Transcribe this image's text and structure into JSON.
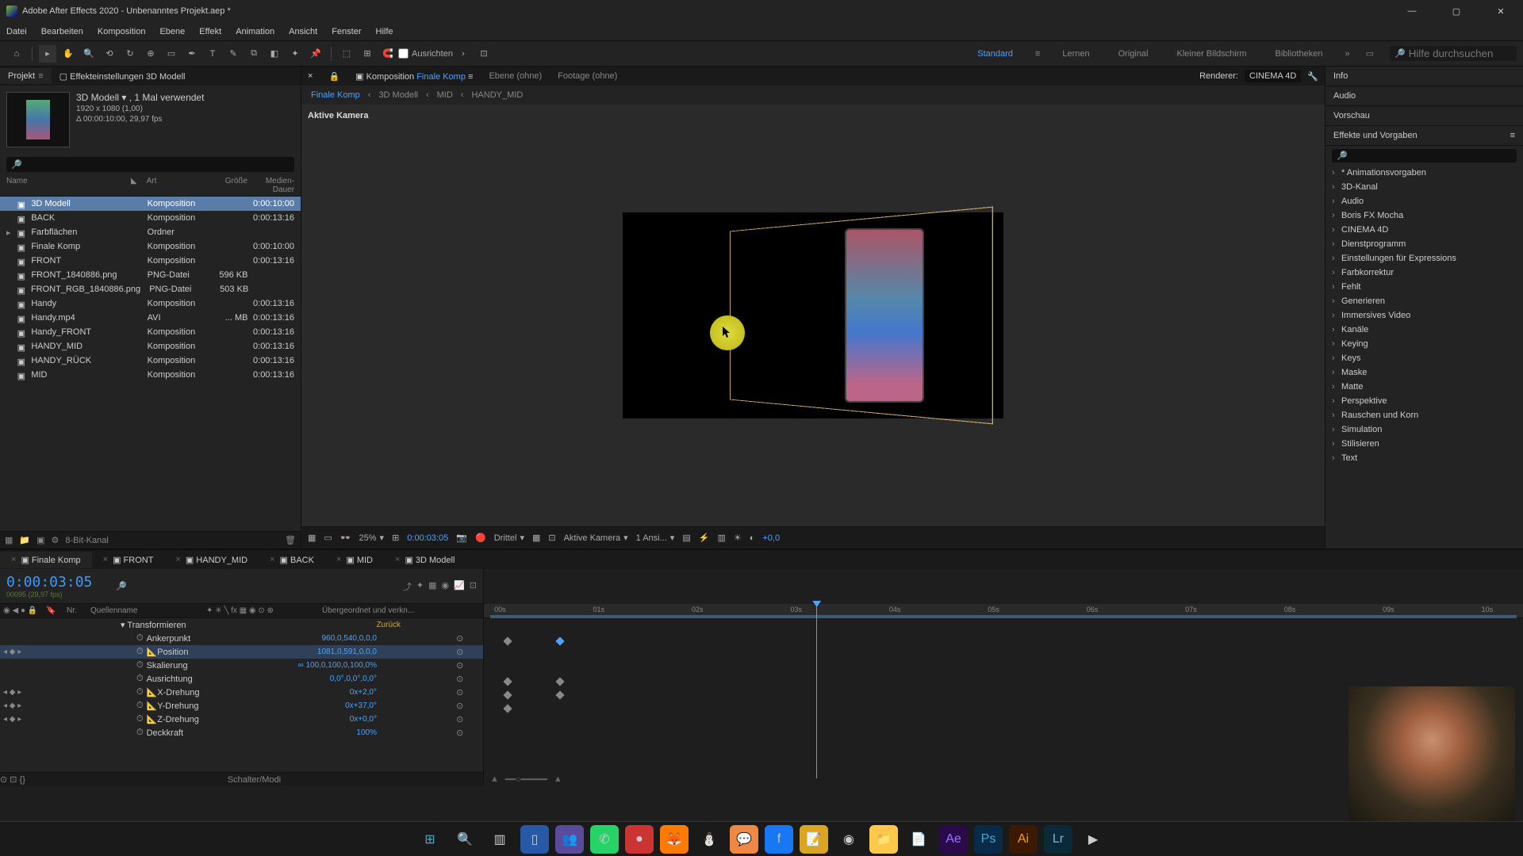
{
  "window": {
    "title": "Adobe After Effects 2020 - Unbenanntes Projekt.aep *"
  },
  "menu": [
    "Datei",
    "Bearbeiten",
    "Komposition",
    "Ebene",
    "Effekt",
    "Animation",
    "Ansicht",
    "Fenster",
    "Hilfe"
  ],
  "toolbar": {
    "align": "Ausrichten",
    "workspaces": [
      "Standard",
      "Lernen",
      "Original",
      "Kleiner Bildschirm",
      "Bibliotheken"
    ],
    "search_placeholder": "Hilfe durchsuchen"
  },
  "project_panel": {
    "tab_project": "Projekt",
    "tab_effect": "Effekteinstellungen 3D Modell",
    "selected_name": "3D Modell",
    "selected_used": "1 Mal verwendet",
    "selected_dims": "1920 x 1080 (1,00)",
    "selected_dur": "Δ 00:00:10:00, 29,97 fps",
    "cols": {
      "name": "Name",
      "type": "Art",
      "size": "Größe",
      "dur": "Medien-Dauer"
    },
    "items": [
      {
        "name": "3D Modell",
        "type": "Komposition",
        "size": "",
        "dur": "0:00:10:00",
        "tag": "y",
        "sel": true
      },
      {
        "name": "BACK",
        "type": "Komposition",
        "size": "",
        "dur": "0:00:13:16",
        "tag": "y"
      },
      {
        "name": "Farbflächen",
        "type": "Ordner",
        "size": "",
        "dur": "",
        "tag": "y"
      },
      {
        "name": "Finale Komp",
        "type": "Komposition",
        "size": "",
        "dur": "0:00:10:00",
        "tag": "y"
      },
      {
        "name": "FRONT",
        "type": "Komposition",
        "size": "",
        "dur": "0:00:13:16",
        "tag": "y"
      },
      {
        "name": "FRONT_1840886.png",
        "type": "PNG-Datei",
        "size": "596 KB",
        "dur": "",
        "tag": "y"
      },
      {
        "name": "FRONT_RGB_1840886.png",
        "type": "PNG-Datei",
        "size": "503 KB",
        "dur": "",
        "tag": "y"
      },
      {
        "name": "Handy",
        "type": "Komposition",
        "size": "",
        "dur": "0:00:13:16",
        "tag": "y"
      },
      {
        "name": "Handy.mp4",
        "type": "AVI",
        "size": "... MB",
        "dur": "0:00:13:16",
        "tag": "o"
      },
      {
        "name": "Handy_FRONT",
        "type": "Komposition",
        "size": "",
        "dur": "0:00:13:16",
        "tag": "y"
      },
      {
        "name": "HANDY_MID",
        "type": "Komposition",
        "size": "",
        "dur": "0:00:13:16",
        "tag": "y"
      },
      {
        "name": "HANDY_RÜCK",
        "type": "Komposition",
        "size": "",
        "dur": "0:00:13:16",
        "tag": "y"
      },
      {
        "name": "MID",
        "type": "Komposition",
        "size": "",
        "dur": "0:00:13:16",
        "tag": "y"
      }
    ],
    "footer_depth": "8-Bit-Kanal"
  },
  "viewer": {
    "tabs": {
      "comp_prefix": "Komposition",
      "comp": "Finale Komp",
      "layer": "Ebene (ohne)",
      "footage": "Footage (ohne)"
    },
    "renderer_label": "Renderer:",
    "renderer": "CINEMA 4D",
    "breadcrumb": [
      "Finale Komp",
      "3D Modell",
      "MID",
      "HANDY_MID"
    ],
    "camera_label": "Aktive Kamera",
    "footer": {
      "zoom": "25%",
      "time": "0:00:03:05",
      "res": "Drittel",
      "view": "Aktive Kamera",
      "views": "1 Ansi...",
      "exposure": "+0,0"
    }
  },
  "right_panel": {
    "info": "Info",
    "audio": "Audio",
    "preview": "Vorschau",
    "ep_title": "Effekte und Vorgaben",
    "ep_items": [
      "* Animationsvorgaben",
      "3D-Kanal",
      "Audio",
      "Boris FX Mocha",
      "CINEMA 4D",
      "Dienstprogramm",
      "Einstellungen für Expressions",
      "Farbkorrektur",
      "Fehlt",
      "Generieren",
      "Immersives Video",
      "Kanäle",
      "Keying",
      "Keys",
      "Maske",
      "Matte",
      "Perspektive",
      "Rauschen und Korn",
      "Simulation",
      "Stilisieren",
      "Text"
    ]
  },
  "timeline": {
    "tabs": [
      "Finale Komp",
      "FRONT",
      "HANDY_MID",
      "BACK",
      "MID",
      "3D Modell"
    ],
    "timecode": "0:00:03:05",
    "subframe": "00095 (29,97 fps)",
    "cols": {
      "nr": "Nr.",
      "source": "Quellenname",
      "parent": "Übergeordnet und verkn..."
    },
    "group": "Transformieren",
    "reset": "Zurück",
    "props": [
      {
        "name": "Ankerpunkt",
        "val": "960,0,540,0,0,0",
        "kf": false
      },
      {
        "name": "Position",
        "val": "1081,0,591,0,0,0",
        "kf": true,
        "sel": true
      },
      {
        "name": "Skalierung",
        "val": "∞ 100,0,100,0,100,0%",
        "kf": false
      },
      {
        "name": "Ausrichtung",
        "val": "0,0°,0,0°,0,0°",
        "kf": false
      },
      {
        "name": "X-Drehung",
        "val": "0x+2,0°",
        "kf": true
      },
      {
        "name": "Y-Drehung",
        "val": "0x+37,0°",
        "kf": true
      },
      {
        "name": "Z-Drehung",
        "val": "0x+0,0°",
        "kf": true
      },
      {
        "name": "Deckkraft",
        "val": "100%",
        "kf": false
      }
    ],
    "footer": "Schalter/Modi",
    "ruler": [
      "00s",
      "01s",
      "02s",
      "03s",
      "04s",
      "05s",
      "06s",
      "07s",
      "08s",
      "09s",
      "10s"
    ]
  },
  "colors": {
    "accent": "#4aa3ff"
  }
}
